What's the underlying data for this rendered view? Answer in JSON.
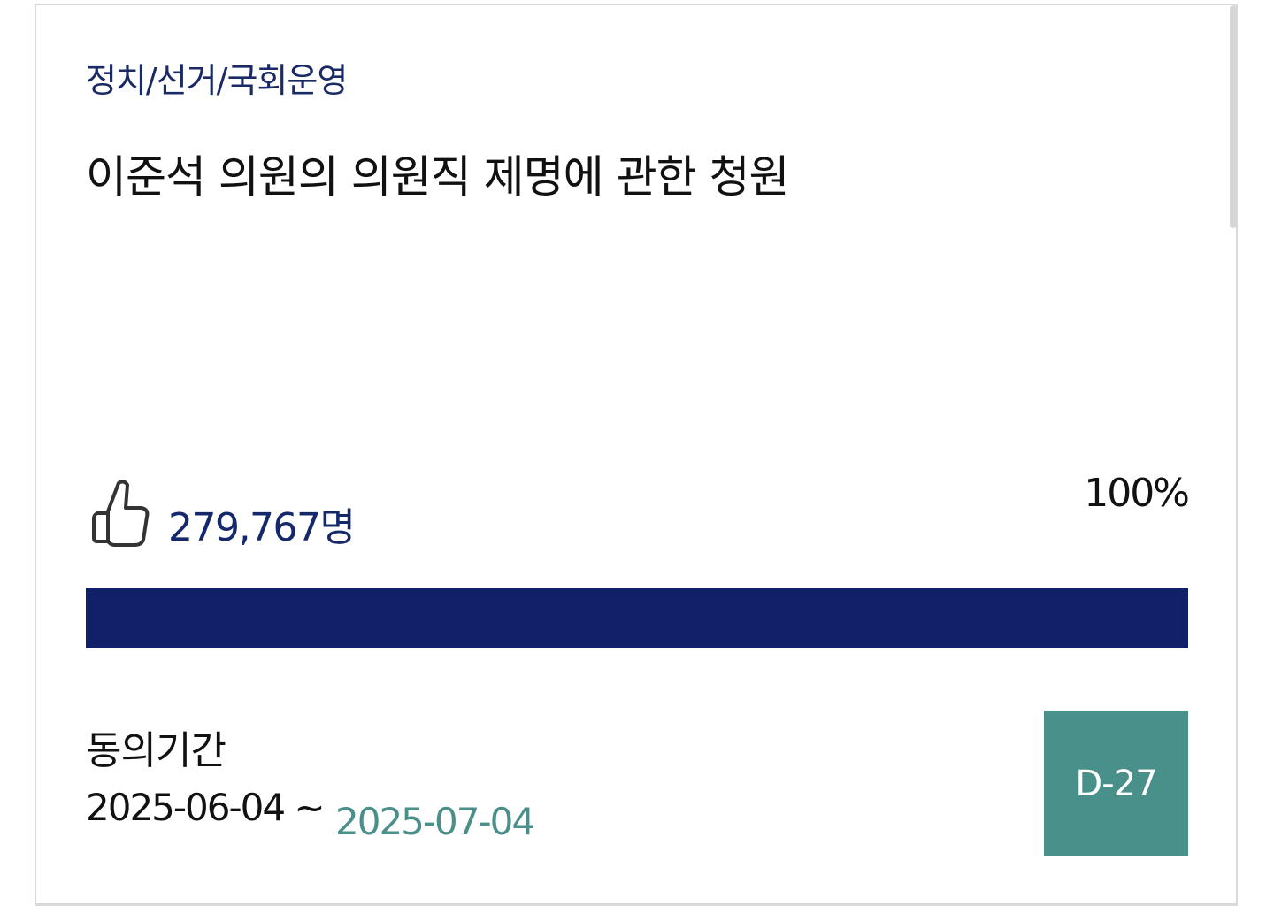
{
  "petition": {
    "category": "정치/선거/국회운영",
    "title": "이준석 의원의 의원직 제명에 관한 청원",
    "agree_count": "279,767명",
    "percent_label": "100%",
    "progress_fraction": 1.0,
    "period_label": "동의기간",
    "period_start": "2025-06-04 ~",
    "period_end": "2025-07-04",
    "dday": "D-27",
    "like_icon": "thumbs-up-icon"
  },
  "colors": {
    "category_text": "#1a2a66",
    "count_text": "#14286b",
    "progress_fill": "#102069",
    "period_end_text": "#4b8f8a",
    "dday_bg": "#4a908a"
  }
}
